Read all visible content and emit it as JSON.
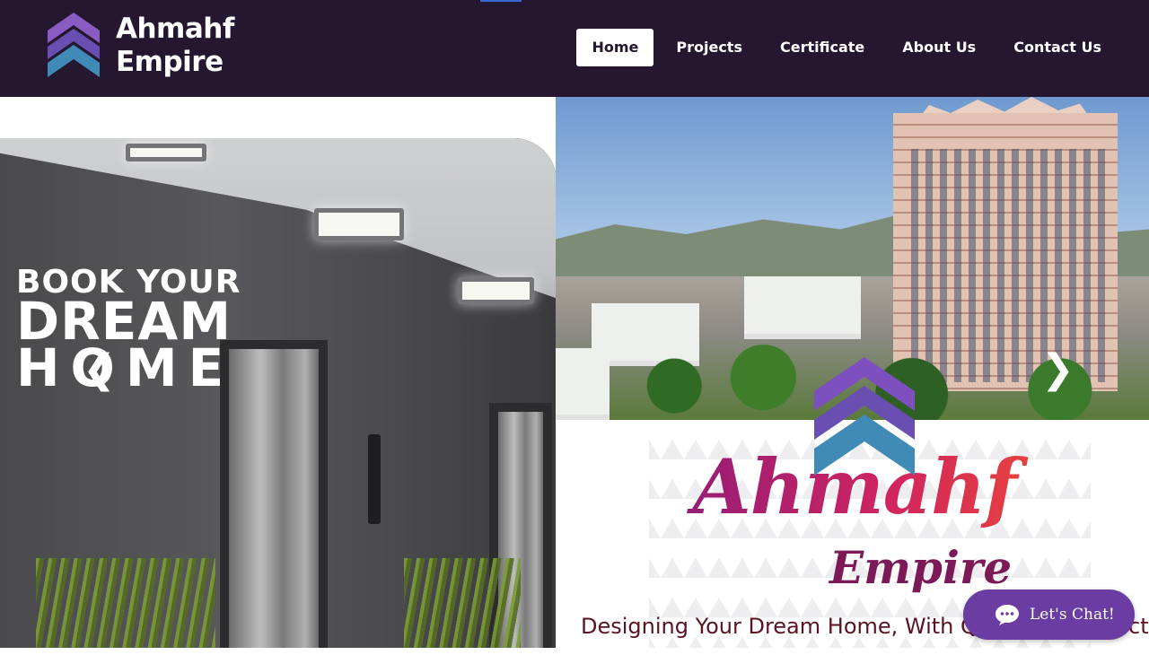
{
  "header": {
    "logo_icon": "house-chevron-logo",
    "brand_line1": "Ahmahf",
    "brand_line2": "Empire",
    "bg_color": "#24172f"
  },
  "nav": {
    "items": [
      {
        "label": "Home",
        "active": true
      },
      {
        "label": "Projects"
      },
      {
        "label": "Certificate"
      },
      {
        "label": "About Us"
      },
      {
        "label": "Contact Us"
      }
    ]
  },
  "hero": {
    "line1": "BOOK YOUR",
    "line2": "DREAM",
    "line3": "HOME",
    "prev_icon": "chevron-left-icon",
    "next_icon": "chevron-right-icon",
    "prev_glyph": "❮",
    "next_glyph": "❯"
  },
  "brand_card": {
    "name": "Ahmahf",
    "sub": "Empire",
    "tagline": "Designing Your Dream Home, With Quality Construction"
  },
  "chat": {
    "label": "Let's Chat!",
    "icon": "chat-bubble-icon",
    "color": "#6b3da3"
  }
}
